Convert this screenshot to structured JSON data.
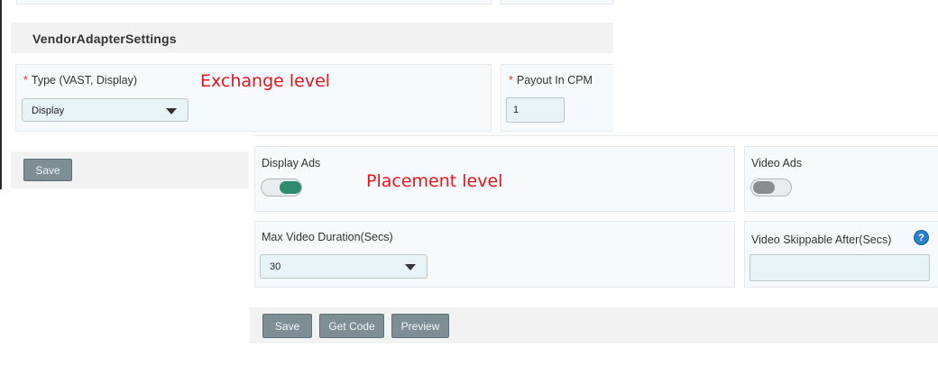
{
  "exchange": {
    "section_title": "VendorAdapterSettings",
    "type_field": {
      "required_mark": "*",
      "label": "Type (VAST, Display)",
      "value": "Display"
    },
    "payout_field": {
      "required_mark": "*",
      "label": "Payout In CPM",
      "value": "1"
    },
    "annotation": "Exchange level",
    "save_label": "Save"
  },
  "placement": {
    "annotation": "Placement level",
    "display_ads": {
      "label": "Display Ads",
      "enabled": true
    },
    "video_ads": {
      "label": "Video Ads",
      "enabled": false
    },
    "max_video_duration": {
      "label": "Max Video Duration(Secs)",
      "value": "30"
    },
    "video_skippable_after": {
      "label": "Video Skippable After(Secs)",
      "value": "",
      "help_icon": "?"
    },
    "buttons": {
      "save": "Save",
      "get_code": "Get Code",
      "preview": "Preview"
    }
  },
  "colors": {
    "annotation": "#e8141c",
    "required": "#d9302c",
    "toggle_on": "#2e8b6c",
    "toggle_off": "#8c8c8c",
    "button_bg": "#7d8e95",
    "input_bg": "#e8f3f7",
    "panel_bg": "#f7fafc",
    "help_icon": "#2a82cc"
  },
  "icons": {
    "select_caret": "chevron-down-icon",
    "help": "help-icon"
  }
}
